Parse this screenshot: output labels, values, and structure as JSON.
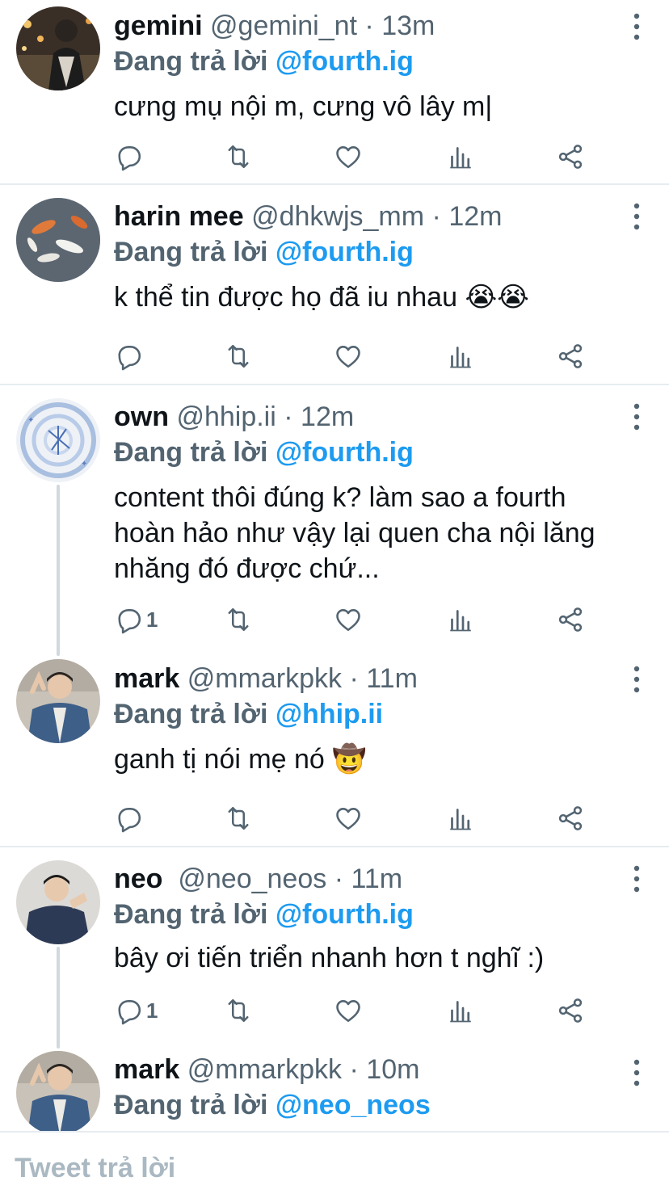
{
  "tweets": [
    {
      "name": "gemini",
      "handle": "@gemini_nt",
      "dot": "·",
      "time": "13m",
      "reply_prefix": "Đang trả lời",
      "reply_to": "@fourth.ig",
      "text": "cưng mụ nội m, cưng vô lây m|",
      "reply_count": "",
      "avatar": "avatar-city-night"
    },
    {
      "name": "harin mee",
      "handle": "@dhkwjs_mm",
      "dot": "·",
      "time": "12m",
      "reply_prefix": "Đang trả lời",
      "reply_to": "@fourth.ig",
      "text": "k thể tin được họ đã iu nhau 😭😭",
      "reply_count": "",
      "avatar": "avatar-koi-fish"
    },
    {
      "name": "own",
      "handle": "@hhip.ii",
      "dot": "·",
      "time": "12m",
      "reply_prefix": "Đang trả lời",
      "reply_to": "@fourth.ig",
      "text": "content thôi đúng k? làm sao a fourth hoàn hảo như vậy lại quen cha nội lăng nhăng đó được chứ...",
      "reply_count": "1",
      "avatar": "avatar-blue-swirl"
    },
    {
      "name": "mark",
      "handle": "@mmarkpkk",
      "dot": "·",
      "time": "11m",
      "reply_prefix": "Đang trả lời",
      "reply_to": "@hhip.ii",
      "text": "ganh tị nói mẹ nó 🤠",
      "reply_count": "",
      "avatar": "avatar-man-denim"
    },
    {
      "name": "neo",
      "handle": "@neo_neos",
      "dot": "·",
      "time": "11m",
      "reply_prefix": "Đang trả lời",
      "reply_to": "@fourth.ig",
      "text": "bây ơi tiến triển nhanh hơn t nghĩ :)",
      "reply_count": "1",
      "avatar": "avatar-man-navy"
    },
    {
      "name": "mark",
      "handle": "@mmarkpkk",
      "dot": "·",
      "time": "10m",
      "reply_prefix": "Đang trả lời",
      "reply_to": "@neo_neos",
      "text": "",
      "reply_count": "",
      "avatar": "avatar-man-denim"
    }
  ],
  "compose": {
    "placeholder": "Tweet trả lời"
  },
  "icons": {
    "reply": "reply-icon",
    "retweet": "retweet-icon",
    "like": "heart-icon",
    "views": "views-icon",
    "share": "share-icon",
    "more": "more-vertical-icon"
  },
  "colors": {
    "link": "#1d9bf0",
    "secondary": "#536471",
    "divider": "#e6ecf0",
    "placeholder": "#aab8c2"
  }
}
